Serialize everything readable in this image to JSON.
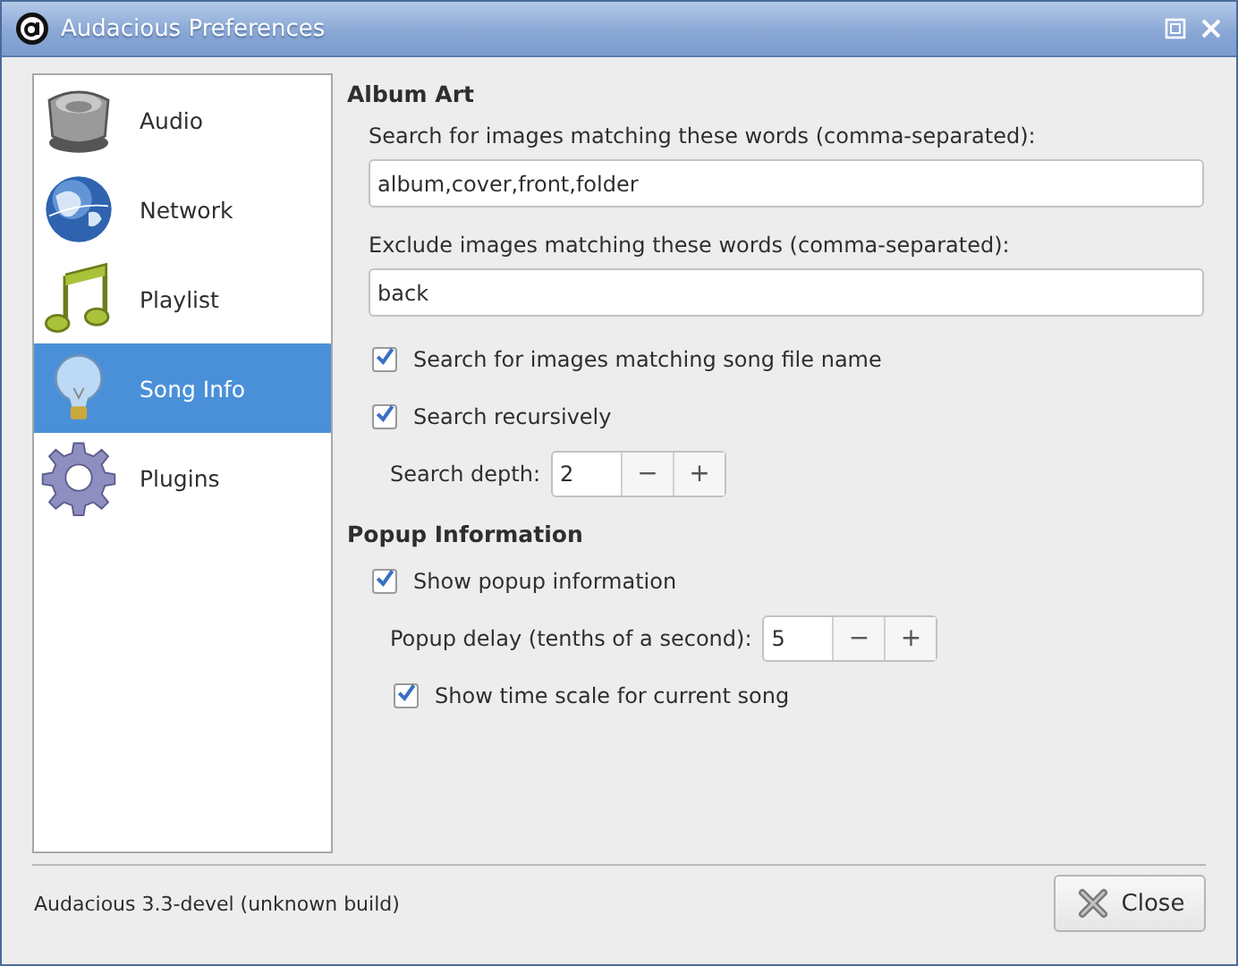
{
  "window": {
    "title": "Audacious Preferences"
  },
  "sidebar": {
    "items": [
      {
        "label": "Audio",
        "kind": "speaker",
        "selected": false
      },
      {
        "label": "Network",
        "kind": "globe",
        "selected": false
      },
      {
        "label": "Playlist",
        "kind": "note",
        "selected": false
      },
      {
        "label": "Song Info",
        "kind": "bulb",
        "selected": true
      },
      {
        "label": "Plugins",
        "kind": "gear",
        "selected": false
      }
    ]
  },
  "sections": [
    {
      "title": "Album Art",
      "items": [
        {
          "kind": "label",
          "text": "Search for images matching these words (comma-separated):"
        },
        {
          "kind": "entry",
          "value": "album,cover,front,folder"
        },
        {
          "kind": "label",
          "text": "Exclude images matching these words (comma-separated):"
        },
        {
          "kind": "entry",
          "value": "back"
        },
        {
          "kind": "check",
          "label": "Search for images matching song file name",
          "checked": true
        },
        {
          "kind": "check",
          "label": "Search recursively",
          "checked": true,
          "children": [
            {
              "kind": "spin",
              "label": "Search depth:",
              "value": "2",
              "decrement": "−",
              "increment": "+"
            }
          ]
        }
      ]
    },
    {
      "title": "Popup Information",
      "items": [
        {
          "kind": "check",
          "label": "Show popup information",
          "checked": true,
          "children": [
            {
              "kind": "spin",
              "label": "Popup delay (tenths of a second):",
              "value": "5",
              "decrement": "−",
              "increment": "+"
            },
            {
              "kind": "check",
              "label": "Show time scale for current song",
              "checked": true
            }
          ]
        }
      ]
    }
  ],
  "footer": {
    "version": "Audacious 3.3-devel (unknown build)",
    "close_button": "Close"
  }
}
